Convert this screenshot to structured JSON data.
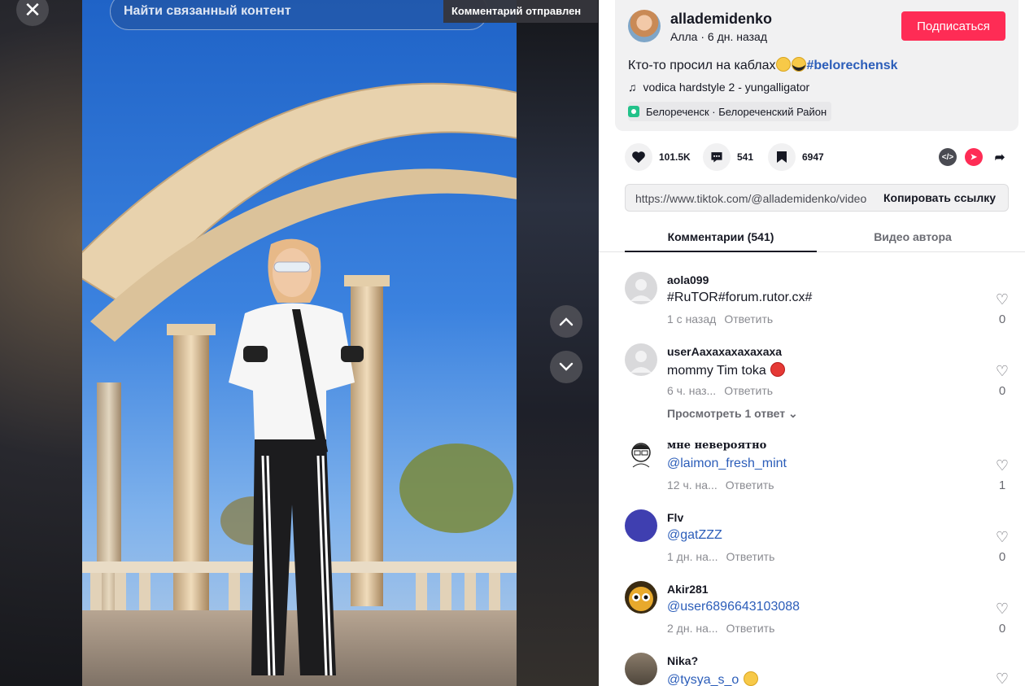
{
  "video": {
    "search_placeholder": "Найти связанный контент",
    "toast": "Комментарий отправлен"
  },
  "author": {
    "username": "allademidenko",
    "subtitle": "Алла · 6 дн. назад",
    "follow_label": "Подписаться",
    "description": "Кто-то просил на каблах",
    "hashtag": "#belorechensk",
    "music": "vodica hardstyle 2 - yungalligator",
    "location": "Белореченск · Белореченский Район"
  },
  "stats": {
    "likes": "101.5K",
    "comments": "541",
    "saves": "6947"
  },
  "link": {
    "url": "https://www.tiktok.com/@allademidenko/video",
    "copy_label": "Копировать ссылку"
  },
  "tabs": {
    "comments": "Комментарии (541)",
    "author_videos": "Видео автора"
  },
  "comments": [
    {
      "user": "aola099",
      "text": "#RuTOR#forum.rutor.cx#",
      "time": "1 с назад",
      "reply": "Ответить",
      "likes": "0"
    },
    {
      "user": "userАахахахахахаха",
      "text": "mommy Tim toka",
      "time": "6 ч. наз...",
      "reply": "Ответить",
      "likes": "0",
      "view_replies": "Просмотреть 1 ответ"
    },
    {
      "user": "мне невероятно",
      "text": "@laimon_fresh_mint",
      "time": "12 ч. на...",
      "reply": "Ответить",
      "likes": "1"
    },
    {
      "user": "Flv",
      "text": "@gatZZZ",
      "time": "1 дн. на...",
      "reply": "Ответить",
      "likes": "0"
    },
    {
      "user": "Akir281",
      "text": "@user6896643103088",
      "time": "2 дн. на...",
      "reply": "Ответить",
      "likes": "0"
    },
    {
      "user": "Nika?",
      "text": "@tysya_s_o",
      "time": "",
      "reply": "",
      "likes": ""
    }
  ],
  "colors": {
    "accent": "#fe2c55",
    "mention": "#2b5db9"
  }
}
